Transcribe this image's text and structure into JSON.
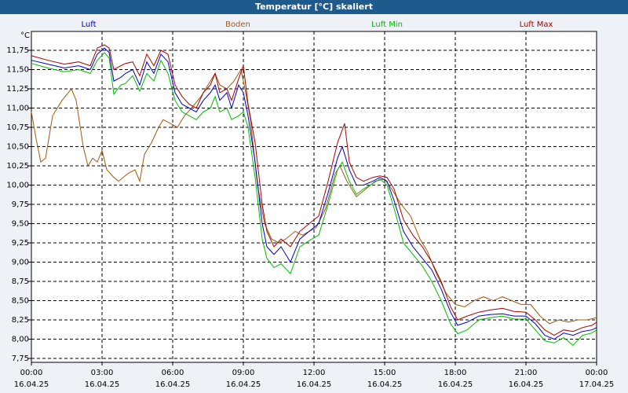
{
  "chart_data": {
    "type": "line",
    "title": "Temperatur [°C] skaliert",
    "ylabel": "°C",
    "ylim": [
      7.75,
      11.85
    ],
    "yticks": [
      "7,75",
      "8,00",
      "8,25",
      "8,50",
      "8,75",
      "9,00",
      "9,25",
      "9,50",
      "9,75",
      "10,00",
      "10,25",
      "10,50",
      "10,75",
      "11,00",
      "11,25",
      "11,50",
      "11,75"
    ],
    "xlim": [
      0,
      24
    ],
    "xticks": [
      {
        "t": "00:00",
        "d": "16.04.25"
      },
      {
        "t": "03:00",
        "d": "16.04.25"
      },
      {
        "t": "06:00",
        "d": "16.04.25"
      },
      {
        "t": "09:00",
        "d": "16.04.25"
      },
      {
        "t": "12:00",
        "d": "16.04.25"
      },
      {
        "t": "15:00",
        "d": "16.04.25"
      },
      {
        "t": "18:00",
        "d": "16.04.25"
      },
      {
        "t": "21:00",
        "d": "16.04.25"
      },
      {
        "t": "00:00",
        "d": "17.04.25"
      }
    ],
    "grid": true,
    "legend_position": "top",
    "series": [
      {
        "name": "Luft",
        "color": "#0000cc",
        "points": [
          [
            0,
            11.62
          ],
          [
            0.7,
            11.57
          ],
          [
            1.4,
            11.52
          ],
          [
            2,
            11.55
          ],
          [
            2.5,
            11.5
          ],
          [
            2.8,
            11.7
          ],
          [
            3.1,
            11.78
          ],
          [
            3.3,
            11.72
          ],
          [
            3.5,
            11.35
          ],
          [
            3.8,
            11.4
          ],
          [
            4,
            11.45
          ],
          [
            4.3,
            11.5
          ],
          [
            4.6,
            11.3
          ],
          [
            4.9,
            11.6
          ],
          [
            5.2,
            11.45
          ],
          [
            5.5,
            11.7
          ],
          [
            5.8,
            11.6
          ],
          [
            6.1,
            11.2
          ],
          [
            6.4,
            11.05
          ],
          [
            6.7,
            11.0
          ],
          [
            7.0,
            10.95
          ],
          [
            7.3,
            11.1
          ],
          [
            7.6,
            11.2
          ],
          [
            7.8,
            11.3
          ],
          [
            8.0,
            11.1
          ],
          [
            8.3,
            11.2
          ],
          [
            8.5,
            11.0
          ],
          [
            8.8,
            11.3
          ],
          [
            9.0,
            11.2
          ],
          [
            9.2,
            10.9
          ],
          [
            9.5,
            10.3
          ],
          [
            9.8,
            9.5
          ],
          [
            10.0,
            9.2
          ],
          [
            10.3,
            9.1
          ],
          [
            10.6,
            9.2
          ],
          [
            11.0,
            9.0
          ],
          [
            11.4,
            9.3
          ],
          [
            11.8,
            9.4
          ],
          [
            12.2,
            9.5
          ],
          [
            12.6,
            9.9
          ],
          [
            13.0,
            10.35
          ],
          [
            13.2,
            10.5
          ],
          [
            13.5,
            10.2
          ],
          [
            13.8,
            10.0
          ],
          [
            14.1,
            10.0
          ],
          [
            14.5,
            10.05
          ],
          [
            14.8,
            10.1
          ],
          [
            15.1,
            10.05
          ],
          [
            15.4,
            9.8
          ],
          [
            15.8,
            9.4
          ],
          [
            16.2,
            9.2
          ],
          [
            16.6,
            9.05
          ],
          [
            17.0,
            8.9
          ],
          [
            17.4,
            8.65
          ],
          [
            17.8,
            8.35
          ],
          [
            18.1,
            8.18
          ],
          [
            18.5,
            8.22
          ],
          [
            19,
            8.3
          ],
          [
            19.5,
            8.32
          ],
          [
            20,
            8.33
          ],
          [
            20.5,
            8.3
          ],
          [
            21,
            8.3
          ],
          [
            21.4,
            8.2
          ],
          [
            21.8,
            8.05
          ],
          [
            22.2,
            8.0
          ],
          [
            22.6,
            8.08
          ],
          [
            23.0,
            8.05
          ],
          [
            23.4,
            8.1
          ],
          [
            23.8,
            8.12
          ],
          [
            24,
            8.15
          ]
        ]
      },
      {
        "name": "Boden",
        "color": "#a05a10",
        "points": [
          [
            0,
            10.95
          ],
          [
            0.2,
            10.6
          ],
          [
            0.4,
            10.3
          ],
          [
            0.6,
            10.35
          ],
          [
            0.9,
            10.9
          ],
          [
            1.3,
            11.1
          ],
          [
            1.7,
            11.25
          ],
          [
            1.9,
            11.1
          ],
          [
            2.2,
            10.5
          ],
          [
            2.4,
            10.25
          ],
          [
            2.6,
            10.35
          ],
          [
            2.8,
            10.3
          ],
          [
            3.0,
            10.45
          ],
          [
            3.2,
            10.2
          ],
          [
            3.5,
            10.1
          ],
          [
            3.7,
            10.05
          ],
          [
            3.9,
            10.1
          ],
          [
            4.1,
            10.15
          ],
          [
            4.4,
            10.2
          ],
          [
            4.6,
            10.05
          ],
          [
            4.8,
            10.4
          ],
          [
            5.1,
            10.55
          ],
          [
            5.4,
            10.75
          ],
          [
            5.6,
            10.85
          ],
          [
            5.9,
            10.8
          ],
          [
            6.2,
            10.75
          ],
          [
            6.5,
            10.9
          ],
          [
            6.8,
            11.0
          ],
          [
            7.2,
            11.15
          ],
          [
            7.5,
            11.3
          ],
          [
            7.8,
            11.45
          ],
          [
            8.0,
            11.3
          ],
          [
            8.3,
            11.25
          ],
          [
            8.6,
            11.35
          ],
          [
            8.9,
            11.5
          ],
          [
            9.1,
            11.2
          ],
          [
            9.3,
            10.85
          ],
          [
            9.6,
            10.0
          ],
          [
            9.9,
            9.5
          ],
          [
            10.2,
            9.3
          ],
          [
            10.5,
            9.25
          ],
          [
            10.8,
            9.3
          ],
          [
            11.2,
            9.4
          ],
          [
            11.5,
            9.35
          ],
          [
            11.8,
            9.4
          ],
          [
            12.1,
            9.45
          ],
          [
            12.5,
            9.7
          ],
          [
            12.9,
            10.15
          ],
          [
            13.1,
            10.25
          ],
          [
            13.4,
            10.05
          ],
          [
            13.8,
            9.85
          ],
          [
            14.2,
            9.95
          ],
          [
            14.6,
            10.05
          ],
          [
            15.0,
            10.08
          ],
          [
            15.3,
            9.95
          ],
          [
            15.7,
            9.75
          ],
          [
            16.1,
            9.6
          ],
          [
            16.5,
            9.3
          ],
          [
            16.8,
            9.15
          ],
          [
            17.2,
            8.85
          ],
          [
            17.6,
            8.6
          ],
          [
            18.0,
            8.45
          ],
          [
            18.4,
            8.42
          ],
          [
            18.8,
            8.5
          ],
          [
            19.2,
            8.55
          ],
          [
            19.6,
            8.5
          ],
          [
            20.0,
            8.55
          ],
          [
            20.4,
            8.5
          ],
          [
            20.8,
            8.45
          ],
          [
            21.2,
            8.45
          ],
          [
            21.6,
            8.3
          ],
          [
            22.0,
            8.2
          ],
          [
            22.4,
            8.25
          ],
          [
            22.8,
            8.22
          ],
          [
            23.2,
            8.25
          ],
          [
            23.6,
            8.25
          ],
          [
            24,
            8.28
          ]
        ]
      },
      {
        "name": "Luft Min",
        "color": "#00bb00",
        "points": [
          [
            0,
            11.58
          ],
          [
            0.7,
            11.52
          ],
          [
            1.4,
            11.47
          ],
          [
            2,
            11.5
          ],
          [
            2.5,
            11.45
          ],
          [
            2.8,
            11.62
          ],
          [
            3.1,
            11.72
          ],
          [
            3.3,
            11.65
          ],
          [
            3.5,
            11.18
          ],
          [
            3.8,
            11.3
          ],
          [
            4,
            11.32
          ],
          [
            4.3,
            11.42
          ],
          [
            4.6,
            11.22
          ],
          [
            4.9,
            11.45
          ],
          [
            5.2,
            11.35
          ],
          [
            5.5,
            11.62
          ],
          [
            5.8,
            11.45
          ],
          [
            6.1,
            11.1
          ],
          [
            6.4,
            10.95
          ],
          [
            6.7,
            10.9
          ],
          [
            7.0,
            10.85
          ],
          [
            7.3,
            10.95
          ],
          [
            7.6,
            11.0
          ],
          [
            7.8,
            11.15
          ],
          [
            8.0,
            10.95
          ],
          [
            8.3,
            11.0
          ],
          [
            8.5,
            10.85
          ],
          [
            8.8,
            10.9
          ],
          [
            9.0,
            10.95
          ],
          [
            9.2,
            10.75
          ],
          [
            9.5,
            10.1
          ],
          [
            9.8,
            9.3
          ],
          [
            10.0,
            9.05
          ],
          [
            10.3,
            8.93
          ],
          [
            10.6,
            8.98
          ],
          [
            11.0,
            8.85
          ],
          [
            11.4,
            9.2
          ],
          [
            11.8,
            9.28
          ],
          [
            12.2,
            9.35
          ],
          [
            12.6,
            9.75
          ],
          [
            13.0,
            10.2
          ],
          [
            13.2,
            10.3
          ],
          [
            13.5,
            10.05
          ],
          [
            13.8,
            9.88
          ],
          [
            14.1,
            9.95
          ],
          [
            14.5,
            10.02
          ],
          [
            14.8,
            10.08
          ],
          [
            15.1,
            10.0
          ],
          [
            15.4,
            9.7
          ],
          [
            15.8,
            9.25
          ],
          [
            16.2,
            9.1
          ],
          [
            16.6,
            8.95
          ],
          [
            17.0,
            8.75
          ],
          [
            17.4,
            8.5
          ],
          [
            17.8,
            8.2
          ],
          [
            18.1,
            8.07
          ],
          [
            18.5,
            8.12
          ],
          [
            19,
            8.25
          ],
          [
            19.5,
            8.28
          ],
          [
            20,
            8.3
          ],
          [
            20.5,
            8.26
          ],
          [
            21,
            8.26
          ],
          [
            21.4,
            8.12
          ],
          [
            21.8,
            7.98
          ],
          [
            22.2,
            7.95
          ],
          [
            22.6,
            8.02
          ],
          [
            23.0,
            7.92
          ],
          [
            23.4,
            8.05
          ],
          [
            23.8,
            8.08
          ],
          [
            24,
            8.12
          ]
        ]
      },
      {
        "name": "Luft Max",
        "color": "#aa0000",
        "points": [
          [
            0,
            11.68
          ],
          [
            0.7,
            11.62
          ],
          [
            1.4,
            11.57
          ],
          [
            2,
            11.6
          ],
          [
            2.5,
            11.55
          ],
          [
            2.8,
            11.78
          ],
          [
            3.1,
            11.82
          ],
          [
            3.3,
            11.78
          ],
          [
            3.5,
            11.5
          ],
          [
            3.8,
            11.55
          ],
          [
            4,
            11.58
          ],
          [
            4.3,
            11.6
          ],
          [
            4.6,
            11.42
          ],
          [
            4.9,
            11.7
          ],
          [
            5.2,
            11.55
          ],
          [
            5.5,
            11.75
          ],
          [
            5.8,
            11.7
          ],
          [
            6.1,
            11.3
          ],
          [
            6.4,
            11.15
          ],
          [
            6.7,
            11.05
          ],
          [
            7.0,
            11.0
          ],
          [
            7.3,
            11.2
          ],
          [
            7.6,
            11.3
          ],
          [
            7.8,
            11.45
          ],
          [
            8.0,
            11.2
          ],
          [
            8.3,
            11.25
          ],
          [
            8.5,
            11.1
          ],
          [
            8.8,
            11.38
          ],
          [
            9.0,
            11.55
          ],
          [
            9.2,
            11.05
          ],
          [
            9.5,
            10.55
          ],
          [
            9.8,
            9.75
          ],
          [
            10.0,
            9.4
          ],
          [
            10.3,
            9.2
          ],
          [
            10.6,
            9.3
          ],
          [
            11.0,
            9.2
          ],
          [
            11.4,
            9.4
          ],
          [
            11.8,
            9.5
          ],
          [
            12.2,
            9.6
          ],
          [
            12.6,
            10.05
          ],
          [
            13.0,
            10.55
          ],
          [
            13.3,
            10.8
          ],
          [
            13.5,
            10.3
          ],
          [
            13.8,
            10.1
          ],
          [
            14.1,
            10.05
          ],
          [
            14.5,
            10.1
          ],
          [
            14.8,
            10.12
          ],
          [
            15.1,
            10.1
          ],
          [
            15.4,
            9.95
          ],
          [
            15.8,
            9.55
          ],
          [
            16.2,
            9.35
          ],
          [
            16.6,
            9.2
          ],
          [
            17.0,
            9.0
          ],
          [
            17.4,
            8.75
          ],
          [
            17.8,
            8.42
          ],
          [
            18.1,
            8.25
          ],
          [
            18.5,
            8.3
          ],
          [
            19,
            8.35
          ],
          [
            19.5,
            8.38
          ],
          [
            20,
            8.4
          ],
          [
            20.5,
            8.36
          ],
          [
            21,
            8.35
          ],
          [
            21.4,
            8.25
          ],
          [
            21.8,
            8.12
          ],
          [
            22.2,
            8.05
          ],
          [
            22.6,
            8.12
          ],
          [
            23.0,
            8.1
          ],
          [
            23.4,
            8.15
          ],
          [
            23.8,
            8.18
          ],
          [
            24,
            8.22
          ]
        ]
      }
    ]
  }
}
